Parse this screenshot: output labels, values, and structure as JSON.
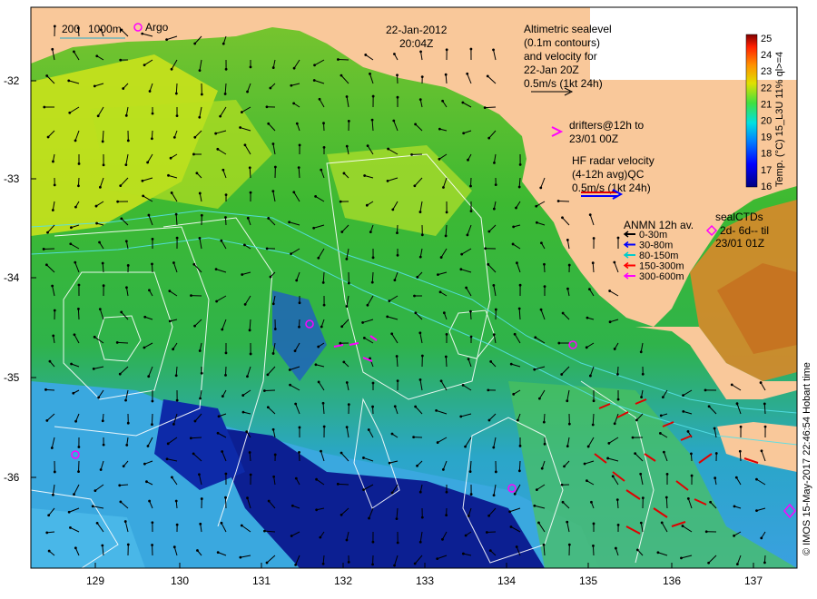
{
  "map": {
    "date": "22-Jan-2012",
    "time": "20:04Z",
    "x_ticks": [
      "129",
      "130",
      "131",
      "132",
      "133",
      "134",
      "135",
      "136",
      "137"
    ],
    "y_ticks": [
      "-32",
      "-33",
      "-34",
      "-35",
      "-36"
    ],
    "scale": {
      "a": "200",
      "b": "1000m"
    },
    "argo_label": "Argo",
    "altimetric": [
      "Altimetric sealevel",
      "(0.1m contours)",
      "and velocity for",
      "22-Jan 20Z",
      "0.5m/s (1kt 24h)"
    ],
    "drifters": [
      "drifters@12h to",
      "23/01 00Z"
    ],
    "hf_radar": [
      "HF radar velocity",
      "(4-12h avg)QC",
      "0.5m/s (1kt 24h)"
    ],
    "anmn": {
      "title": "ANMN 12h av.",
      "items": [
        {
          "label": "0-30m",
          "color": "#000000"
        },
        {
          "label": "30-80m",
          "color": "#0000ff"
        },
        {
          "label": "80-150m",
          "color": "#00cccc"
        },
        {
          "label": "150-300m",
          "color": "#ff0000"
        },
        {
          "label": "300-600m",
          "color": "#ff00ff"
        }
      ]
    },
    "sealctds": [
      "sealCTDs",
      "2d- 6d-- til",
      "23/01 01Z"
    ],
    "colorbar": {
      "ticks": [
        "25",
        "24",
        "23",
        "22",
        "21",
        "20",
        "19",
        "18",
        "17",
        "16"
      ],
      "label": "Temp. (°C) 15_L3U 11% ql>=4"
    },
    "credit": "© IMOS 15-May-2017 22:46:54 Hobart time",
    "colors": {
      "land": "#f9c89a",
      "sst_warm": "#c8e21a",
      "sst_mid": "#33b830",
      "sst_cool": "#3fa6e0",
      "sst_cold": "#0a1a8a"
    }
  }
}
